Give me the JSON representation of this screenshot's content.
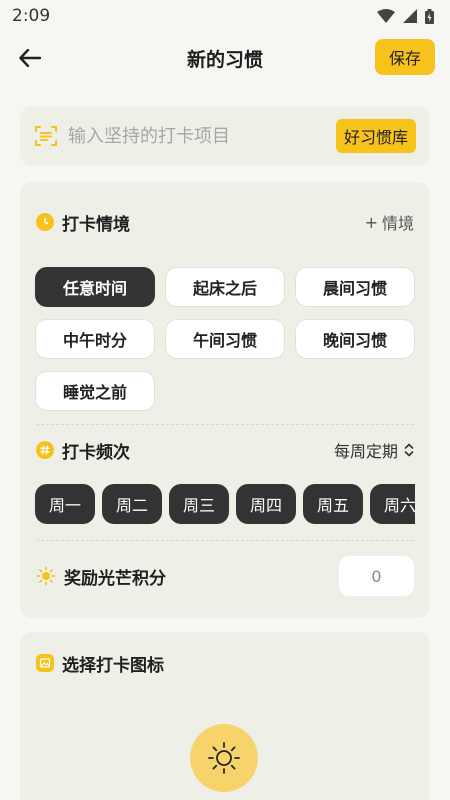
{
  "status_bar": {
    "time": "2:09"
  },
  "header": {
    "title": "新的习惯",
    "save_label": "保存"
  },
  "habit_input": {
    "placeholder": "输入坚持的打卡项目",
    "library_label": "好习惯库"
  },
  "context": {
    "title": "打卡情境",
    "add_label": "情境",
    "options": [
      "任意时间",
      "起床之后",
      "晨间习惯",
      "中午时分",
      "午间习惯",
      "晚间习惯",
      "睡觉之前"
    ],
    "selected": "任意时间"
  },
  "frequency": {
    "title": "打卡频次",
    "mode": "每周定期",
    "days": [
      "周一",
      "周二",
      "周三",
      "周四",
      "周五",
      "周六"
    ]
  },
  "reward": {
    "title": "奖励光芒积分",
    "value": "0"
  },
  "icon_picker": {
    "title": "选择打卡图标"
  },
  "colors": {
    "accent": "#f7c21c",
    "chip_dark": "#333333",
    "card_bg": "#eef0e8",
    "page_bg": "#f6f7f2"
  }
}
